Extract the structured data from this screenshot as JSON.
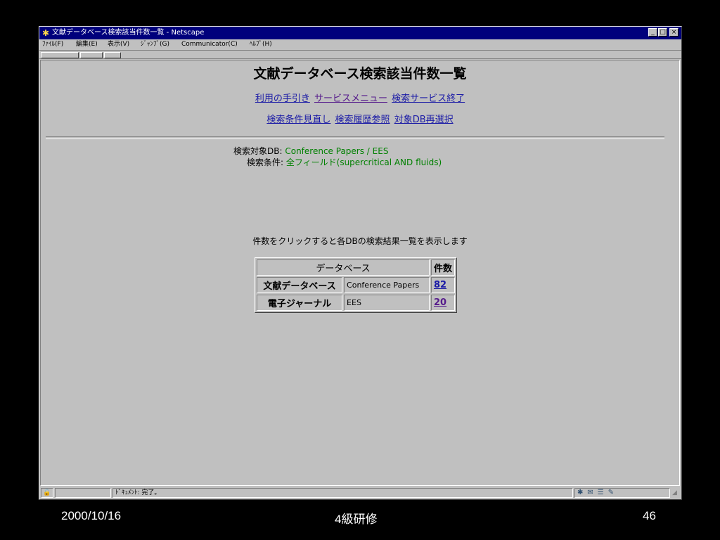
{
  "window": {
    "title": "文献データベース検索該当件数一覧 - Netscape",
    "controls": {
      "minimize": "_",
      "maximize": "□",
      "close": "×"
    }
  },
  "menubar": {
    "items": [
      "ﾌｧｲﾙ(F)",
      "編集(E)",
      "表示(V)",
      "ｼﾞｬﾝﾌﾟ(G)",
      "Communicator(C)",
      "ﾍﾙﾌﾟ(H)"
    ]
  },
  "page": {
    "title": "文献データベース検索該当件数一覧",
    "nav_row1": [
      {
        "label": "利用の手引き",
        "visited": false
      },
      {
        "label": "サービスメニュー",
        "visited": true
      },
      {
        "label": "検索サービス終了",
        "visited": false
      }
    ],
    "nav_row2": [
      {
        "label": "検索条件見直し",
        "visited": false
      },
      {
        "label": "検索履歴参照",
        "visited": false
      },
      {
        "label": "対象DB再選択",
        "visited": false
      }
    ],
    "search_info": {
      "db_label": "検索対象DB:",
      "db_value": "Conference Papers / EES",
      "cond_label": "検索条件:",
      "cond_value": "全フィールド(supercritical AND fluids)"
    },
    "instruction": "件数をクリックすると各DBの検索結果一覧を表示します",
    "table": {
      "header_db": "データベース",
      "header_count": "件数",
      "rows": [
        {
          "category": "文献データベース",
          "db": "Conference Papers",
          "count": "82",
          "visited": false
        },
        {
          "category": "電子ジャーナル",
          "db": "EES",
          "count": "20",
          "visited": true
        }
      ]
    }
  },
  "status": {
    "text": "ﾄﾞｷｭﾒﾝﾄ: 完了。"
  },
  "footer": {
    "date": "2000/10/16",
    "center": "4級研修",
    "page_number": "46"
  }
}
